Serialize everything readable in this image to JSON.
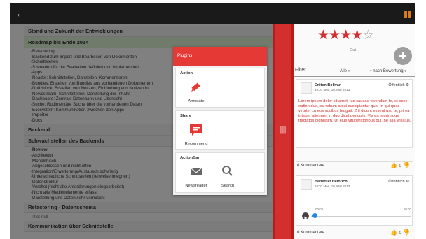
{
  "topbar": {
    "back_icon": "arrow-left-icon",
    "menu_icon": "grid-icon"
  },
  "outline": {
    "s1": "Stand und Zukunft der Entwicklungen",
    "s2": "Roadmap bis Ende 2014",
    "roadmap_items": [
      "-Refactoring",
      "-Backend zum Import und Bearbeiten von Dokumenten",
      "-Schnittstellen",
      "-Szenarien für die Evaluation definiert und implementiert",
      "-Apps",
      "-Reader: Schnittstellen, Darstellen, Kommentieren",
      "-Bundles: Erstellen von Bundles aus vorhandenen Dokumenten",
      "-Notizblock: Erstellen von Notizen, Einbindung von Notizen in",
      "-Newsstream: Schnittstellen, Darstellung der Inhalte",
      "-Dashboard: Zentrale Datenbank und Übersicht",
      "-Suche: Rudimentäre Suche über die vorhandenen Daten",
      "-Ecosystem: Kommunikation zwischen den Apps",
      "-Importer",
      "-Docs"
    ],
    "s3": "Backend",
    "s4": "Schwachstellen des Backends",
    "weak_items": [
      "-Review",
      "-Architektur",
      "-Monolithisch",
      "-Abgeschlossen und nicht offen",
      "-Integration/Erweiterung/Austausch schwierig",
      "-Unterschiedliche Schnittstellen (teilweise integriert)",
      "-Datenstruktur",
      "-Veraltet (nicht alle Anforderungen eingearbeitet)",
      "-Nicht alle Medienelemente erfasst",
      "-Darstellung und Daten sehr vermischt"
    ],
    "s5": "Refactoring - Datenschema",
    "title_null": "Title: null",
    "s6": "Kommunikation über Schnittstelle"
  },
  "dialog": {
    "title": "Plugins",
    "groups": [
      {
        "label": "Action",
        "items": [
          {
            "label": "Annotate",
            "icon": "annotate-icon"
          }
        ]
      },
      {
        "label": "Share",
        "items": [
          {
            "label": "Recommend",
            "icon": "recommend-icon"
          }
        ]
      },
      {
        "label": "ActionBar",
        "items": [
          {
            "label": "Newsreader",
            "icon": "mail-icon"
          },
          {
            "label": "Search",
            "icon": "search-icon"
          }
        ]
      }
    ]
  },
  "rating": {
    "value": 4,
    "max": 5,
    "label": "Gut"
  },
  "filter": {
    "label": "Filter",
    "scope": "Alle",
    "sort": "nach Bewertung"
  },
  "comments": [
    {
      "name": "Eniten Bolivar",
      "date": "19:07 Mon, 10. Mar 2013",
      "visibility": "Öffentlich",
      "text": "Lorem ipsum dolor sit amet, ius causae vivendum te, et esse option duo, eu rebum atqui suscipiantur quo. In qui quas virtute, cu eos vocibus feugait. Zril dicunt essent usu te, pri ea integer alienum, in duo dicat periculis. Vis ea reprimique tractatos dignissim. Ut eius vituperatoribus qui, ne alia wisi ius.",
      "comment_count": "0 Kommentare",
      "likes": "0"
    },
    {
      "name": "Benedikt Heinrich",
      "date": "19:07 Mon, 10. Mar 2013",
      "visibility": "Öffentlich",
      "time_start": "00:00",
      "time_end": "00:00",
      "comment_count": "0 Kommentare",
      "likes": "0"
    }
  ],
  "colors": {
    "accent": "#d32f2f",
    "header_red": "#e53935"
  }
}
